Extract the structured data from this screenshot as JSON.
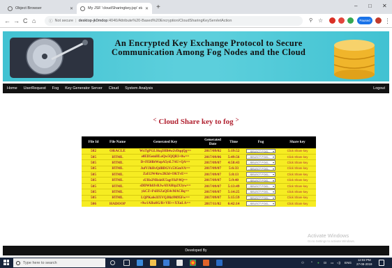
{
  "browser": {
    "tabs": [
      {
        "title": "Object Browser",
        "active": false
      },
      {
        "title": "My JSF 'cloudSharingkey.jsp' sta",
        "active": true
      }
    ],
    "new_tab": "+",
    "window_controls": {
      "minimize": "–",
      "maximize": "□",
      "close": "✕"
    },
    "nav": {
      "back": "←",
      "forward": "→",
      "reload": "C",
      "home": "⌂"
    },
    "security_label": "Not secure",
    "url_host": "desktop-jk0mdop",
    "url_path": ":4040/Attribute%20-Based%20Encryption/CloudSharingKeyServletAction",
    "paused_label": "Paused",
    "menu": "⋮"
  },
  "banner": {
    "title": "An Encrypted Key Exchange Protocol to Secure Communication Among Fog Nodes and the Cloud"
  },
  "nav": {
    "items": [
      "Home",
      "UserRequest",
      "Fog",
      "Key Generator Server",
      "Cloud",
      "System Analysis"
    ],
    "logout": "Logout"
  },
  "main": {
    "heading_left": "<",
    "heading": "Cloud Share key to fog",
    "heading_right": ">",
    "table": {
      "headers": [
        "File Id",
        "File Name",
        "Generated Key",
        "Generated Date",
        "Time",
        "Fog",
        "Share key"
      ],
      "rows": [
        {
          "id": "502",
          "name": "ORACLE",
          "key": "WxTgPGLSkq3HB4w2vDqqQg==",
          "date": "2017/09/02",
          "time": "5:19:52",
          "fog": "--SELECT FOG--",
          "action": "Click Share key"
        },
        {
          "id": "505",
          "name": "HTML",
          "key": "e0ED5emHLoQw5QQR3+0w==",
          "date": "2017/09/06",
          "time": "5:49:56",
          "fog": "--SELECT FOG--",
          "action": "Click Share key"
        },
        {
          "id": "505",
          "name": "HTML",
          "key": "D+Fl50BtWupA5ytL7AU+QA==",
          "date": "2017/09/07",
          "time": "4:58:43",
          "fog": "--SELECT FOG--",
          "action": "Click Share key"
        },
        {
          "id": "505",
          "name": "HTML",
          "key": "JufVJhHvQdBDGVc53GmVA==",
          "date": "2017/09/07",
          "time": "5:6:33",
          "fog": "--SELECT FOG--",
          "action": "Click Share key"
        },
        {
          "id": "505",
          "name": "HTML",
          "key": "ZaI12W4irw2KId+OKTvE==",
          "date": "2017/09/07",
          "time": "5:8:13",
          "fog": "--SELECT FOG--",
          "action": "Click Share key"
        },
        {
          "id": "505",
          "name": "HTML",
          "key": "sUHe2NRsk6U5sgtYkP/0Q==",
          "date": "2017/09/07",
          "time": "5:9:40",
          "fog": "--SELECT FOG--",
          "action": "Click Share key"
        },
        {
          "id": "505",
          "name": "HTML",
          "key": "sDDWh8JvRJwAYAHtp2X3yw==",
          "date": "2017/09/07",
          "time": "5:13:49",
          "fog": "--SELECT FOG--",
          "action": "Click Share key"
        },
        {
          "id": "505",
          "name": "HTML",
          "key": "ykCZ+PsHSZaQE4vMACBq==",
          "date": "2017/09/07",
          "time": "5:14:25",
          "fog": "--SELECT FOG--",
          "action": "Click Share key"
        },
        {
          "id": "505",
          "name": "HTML",
          "key": "LQPKa6s3IXVQJ8iz9M95Fw==",
          "date": "2017/09/07",
          "time": "5:15:59",
          "fog": "--SELECT FOG--",
          "action": "Click Share key"
        },
        {
          "id": "506",
          "name": "HADOOP",
          "key": "+9w1AIbz8G/R+VH++XXnLA==",
          "date": "2017/11/02",
          "time": "6:42:14",
          "fog": "--SELECT FOG--",
          "action": "Click Share key"
        }
      ]
    }
  },
  "watermark": {
    "title": "Activate Windows",
    "subtitle": "Go to Settings to activate Windows."
  },
  "footer": {
    "text": "Developed By"
  },
  "taskbar": {
    "search_placeholder": "Type here to search",
    "language": "ENG",
    "time": "12:02 PM",
    "date": "27-08-2019"
  },
  "colors": {
    "banner": "#5ccfdc",
    "nav_bg": "#121212",
    "heading": "#b01f2e",
    "table_header": "#000000",
    "table_row": "#f6ec22",
    "table_text": "#a3223a",
    "taskbar": "#17233a"
  }
}
